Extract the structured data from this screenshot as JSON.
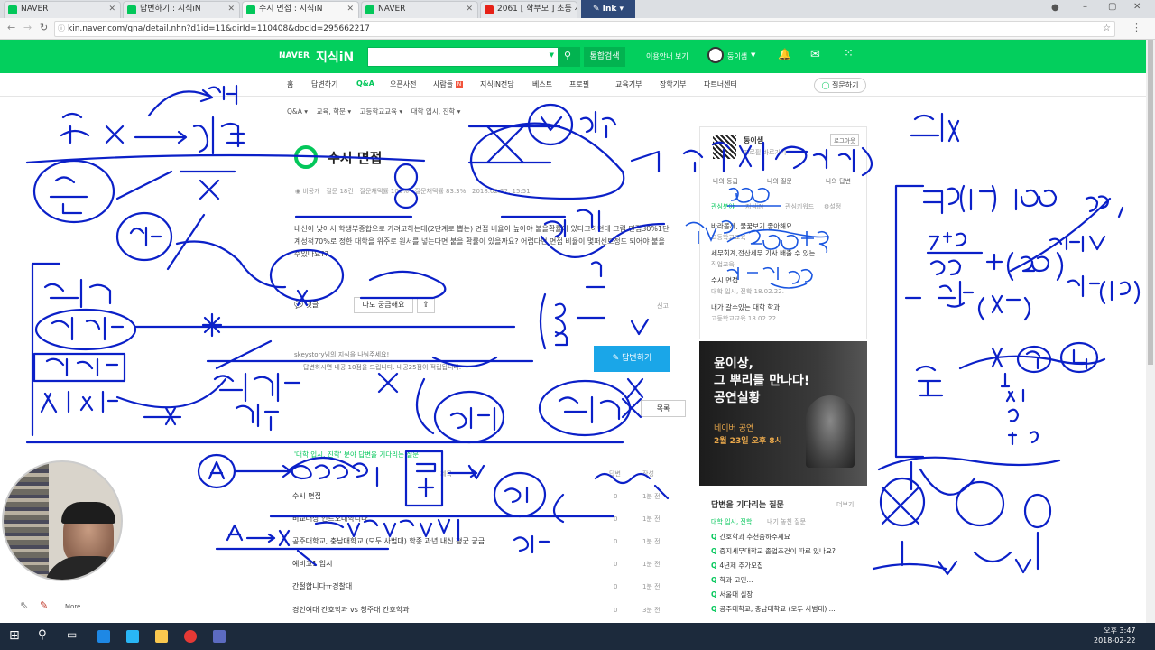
{
  "tabs": [
    {
      "title": "NAVER",
      "fav": "#03c75a"
    },
    {
      "title": "답변하기 : 지식iN",
      "fav": "#03c75a"
    },
    {
      "title": "수시 면접 : 지식iN",
      "fav": "#03c75a"
    },
    {
      "title": "NAVER",
      "fav": "#03c75a"
    },
    {
      "title": "2061 [ 학부모 ] 초등 저",
      "fav": "#e62117"
    }
  ],
  "ink_label": "Ink",
  "url": "kin.naver.com/qna/detail.nhn?d1id=11&dirId=110408&docId=295662217",
  "header": {
    "logo_naver": "NAVER",
    "logo_kin": "지식iN",
    "search_button": "통합검색",
    "guide": "이용안내 보기",
    "user": "둥이샘"
  },
  "menu": [
    "홈",
    "답변하기",
    "Q&A",
    "오픈사전",
    "사람들",
    "지식iN전당",
    "베스트",
    "프로필",
    "교육기부",
    "장학기부",
    "파트너센터"
  ],
  "ask_button": "질문하기",
  "breadcrumb": [
    "Q&A",
    "교육, 학문",
    "고등학교교육",
    "대학 입시, 진학"
  ],
  "question": {
    "title": "수시 면접",
    "author": "비공개",
    "q_count": "질문 18건",
    "adopt": "질문채택률 100%",
    "answer_rate": "질문채택률 83.3%",
    "date": "2018.02.22. 15:51",
    "body": "내신이 낮아서 학생부종합으로 가려고하는데(2단계로 뽑는) 면접 비율이 높아야 붙을확률이 있다고하던데 그럼 면접30%1단계성적70%로 정한 대학을 위주로 원서를 넣는다면 붙을 확률이 있을까요? 어렵다면 면접 비율이 몇퍼센트정도 되어야 붙을수있나요??",
    "comment": "댓글",
    "curious": "나도 궁금해요",
    "report": "신고"
  },
  "answerer": {
    "id": "skeystory",
    "line1": "skeystory님의 지식을 나눠주세요!",
    "line2": "답변하시면 내공 10점을 드립니다. 내공25점이 적립됩니다.",
    "answer_button": "답변하기",
    "list_button": "목록"
  },
  "waiting_list": {
    "header": "'대학 입시, 진학' 분야 답변을 기다리는 질문",
    "col_title": "제목",
    "col_answer": "답변",
    "col_date": "작성",
    "rows": [
      {
        "title": "수시 면접",
        "answers": "0",
        "date": "1분 전"
      },
      {
        "title": "비교대상 인트오대학니다",
        "answers": "0",
        "date": "1분 전"
      },
      {
        "title": "공주대학교, 충남대학교 (모두 사범대) 학종 과년 내신 평균 궁금",
        "answers": "0",
        "date": "1분 전"
      },
      {
        "title": "예비고1 입시",
        "answers": "0",
        "date": "1분 전"
      },
      {
        "title": "간절합니다ㅠ경찰대",
        "answers": "0",
        "date": "1분 전"
      },
      {
        "title": "경인여대 간호학과 vs 청주대 간호학과",
        "answers": "0",
        "date": "3분 전"
      }
    ]
  },
  "profile": {
    "name": "둥이샘",
    "logout": "로그아웃",
    "sub": "프로필 바로가기",
    "level_label": "나의 등급",
    "my_q": "나의 질문",
    "my_a": "나의 답변",
    "interest_tab": "관심분야",
    "kin_tab": "지식iN",
    "keyword_tab": "관심키워드",
    "setting": "설정",
    "list": [
      {
        "title": "바라볼께, 물꿈보기 좋아해요",
        "meta": "고등학교교육"
      },
      {
        "title": "세무회계,전산세무 기사 배출 수 있는 ...",
        "meta": "직업교육"
      },
      {
        "title": "수시 면접",
        "meta": "대학 입시, 진학  18.02.22."
      },
      {
        "title": "내가 갈수있는 대학 학과",
        "meta": "고등학교교육  18.02.22."
      }
    ]
  },
  "ad": {
    "line1": "윤이상,",
    "line2": "그 뿌리를 만나다!",
    "line3": "공연실황",
    "line4": "네이버 공연",
    "line5": "2월 23일 오후 8시"
  },
  "right_waiting": {
    "title": "답변을 기다리는 질문",
    "more": "더보기",
    "tabs_active": "대학 입시, 진학",
    "tabs_other": "내기 놓친 질문",
    "items": [
      "간호학과 추천좀하주세요",
      "중지세무대학교 졸업조건이 따로 있나요?",
      "4년제 추가모집",
      "학과 고민...",
      "서울대 실장",
      "공주대학교, 충남대학교 (모두 사범대) ..."
    ]
  },
  "webcam_label": "More",
  "clock": {
    "time": "오후 3:47",
    "date": "2018-02-22"
  },
  "colors": {
    "naver_green": "#03c75a",
    "ink": "#0b20c8",
    "answer_btn": "#1aa6e8"
  }
}
